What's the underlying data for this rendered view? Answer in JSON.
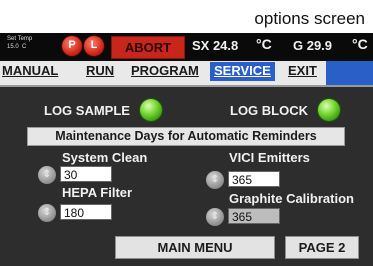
{
  "caption": "options screen",
  "topbar": {
    "set_temp_label": "Set Temp",
    "set_temp_value": "15.0",
    "set_temp_unit": "C",
    "btn1_label": "P",
    "btn2_label": "L",
    "abort_label": "ABORT",
    "sx_label": "SX 24.8",
    "sx_unit": "°C",
    "g_label": "G 29.9",
    "g_unit": "°C"
  },
  "nav": {
    "manual": "MANUAL",
    "run": "RUN",
    "program": "PROGRAM",
    "service": "SERVICE",
    "exit": "EXIT",
    "active": "SERVICE"
  },
  "indicators": {
    "log_sample": "LOG SAMPLE",
    "log_block": "LOG BLOCK"
  },
  "maintenance": {
    "header": "Maintenance Days for Automatic Reminders",
    "system_clean_label": "System Clean",
    "system_clean_value": "30",
    "vici_label": "VICI Emitters",
    "vici_value": "365",
    "hepa_label": "HEPA Filter",
    "hepa_value": "180",
    "graphite_label": "Graphite Calibration",
    "graphite_value": "365"
  },
  "footer": {
    "main_menu": "MAIN MENU",
    "page": "PAGE 2"
  },
  "colors": {
    "abort": "#c7261b",
    "nav_active": "#2a5fc7",
    "led": "#6fd12d",
    "panel": "#2d2d2d"
  }
}
